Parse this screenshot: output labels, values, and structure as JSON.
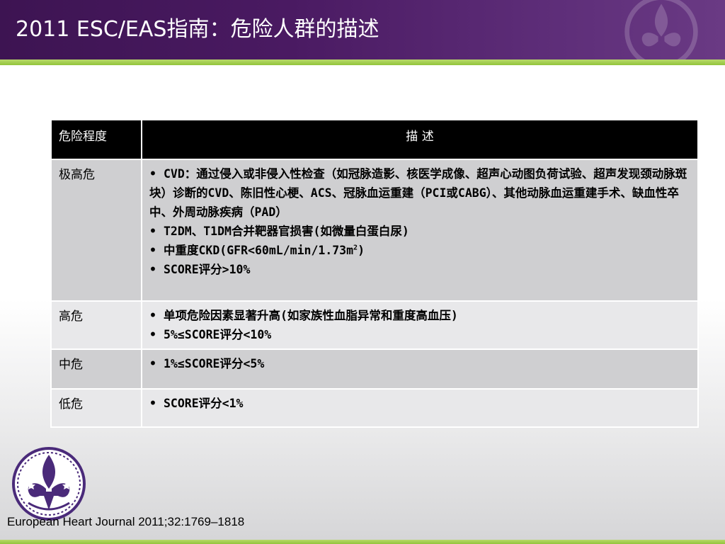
{
  "slide": {
    "title": "2011 ESC/EAS指南：危险人群的描述",
    "citation": "European Heart Journal 2011;32:1769–1818"
  },
  "colors": {
    "title_bar": "#4a1a62",
    "accent_green": "#93c43c",
    "header_bg": "#000000",
    "row_dark": "#cfcfd1",
    "row_light": "#e8e8ea",
    "logo_purple": "#4a2a7a"
  },
  "icons": {
    "logo": "fleur-de-lis-emblem-icon",
    "watermark": "fleur-de-lis-watermark-icon"
  },
  "table": {
    "headers": [
      "危险程度",
      "描 述"
    ],
    "bullet": "•",
    "rows": [
      {
        "level": "极高危",
        "items": [
          "CVD：通过侵入或非侵入性检查（如冠脉造影、核医学成像、超声心动图负荷试验、超声发现颈动脉斑块）诊断的CVD、陈旧性心梗、ACS、冠脉血运重建（PCI或CABG）、其他动脉血运重建手术、缺血性卒中、外周动脉疾病（PAD）",
          "T2DM、T1DM合并靶器官损害(如微量白蛋白尿)",
          "中重度CKD(GFR<60mL/min/1.73m",
          "SCORE评分>10%"
        ],
        "superscript": "2",
        "suffix": ")"
      },
      {
        "level": "高危",
        "items": [
          "单项危险因素显著升高(如家族性血脂异常和重度高血压)",
          "5%≤SCORE评分<10%"
        ]
      },
      {
        "level": "中危",
        "items": [
          "1%≤SCORE评分<5%"
        ]
      },
      {
        "level": "低危",
        "items": [
          "SCORE评分<1%"
        ]
      }
    ]
  }
}
